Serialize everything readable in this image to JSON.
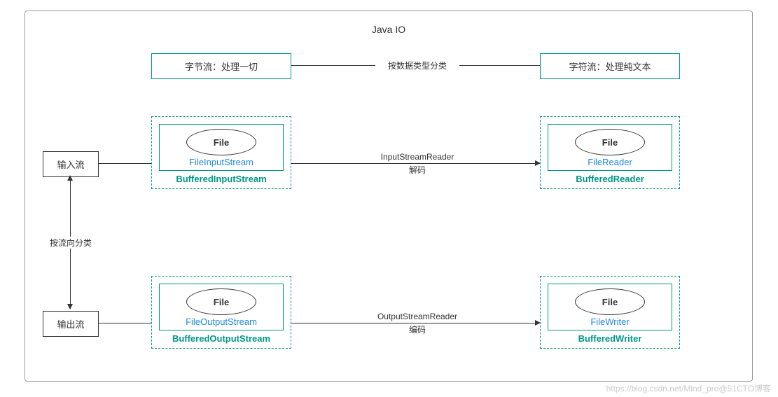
{
  "title": "Java IO",
  "top_row": {
    "left_box": "字节流：处理一切",
    "connector": "按数据类型分类",
    "right_box": "字符流：处理纯文本"
  },
  "left_side": {
    "input": "输入流",
    "connector": "按流向分类",
    "output": "输出流"
  },
  "blocks": {
    "input_byte": {
      "file": "File",
      "inner": "FileInputStream",
      "outer": "BufferedInputStream"
    },
    "input_char": {
      "file": "File",
      "inner": "FileReader",
      "outer": "BufferedReader"
    },
    "output_byte": {
      "file": "File",
      "inner": "FileOutputStream",
      "outer": "BufferedOutputStream"
    },
    "output_char": {
      "file": "File",
      "inner": "FileWriter",
      "outer": "BufferedWriter"
    }
  },
  "mid_connectors": {
    "input": {
      "line1": "InputStreamReader",
      "line2": "解码"
    },
    "output": {
      "line1": "OutputStreamReader",
      "line2": "编码"
    }
  },
  "watermark": "https://blog.csdn.net/Mind_pro@51CTO博客"
}
